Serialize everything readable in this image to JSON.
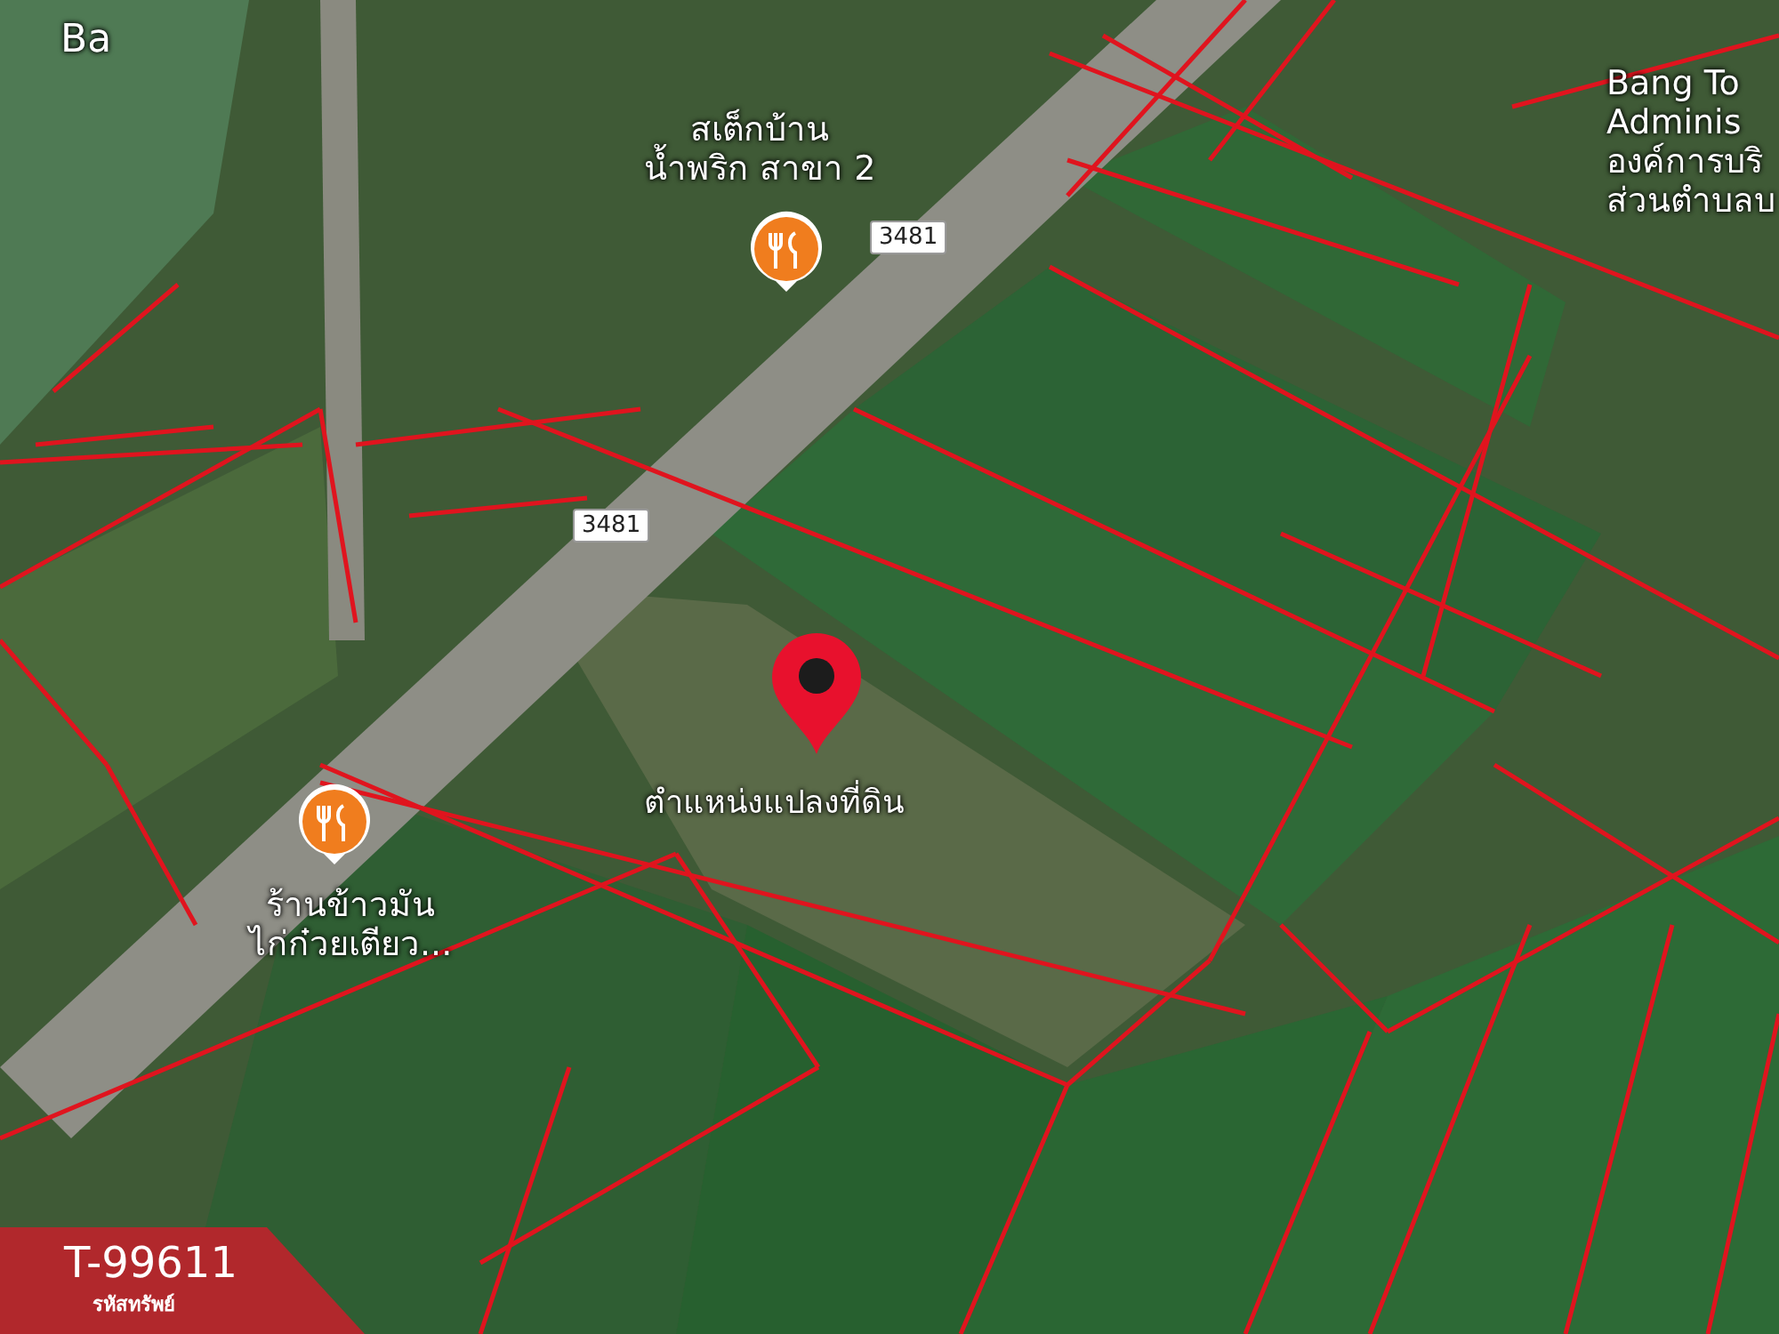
{
  "map": {
    "place_labels": [
      {
        "kind": "place",
        "lines": [
          "Ba"
        ]
      },
      {
        "kind": "place",
        "lines": [
          "สเต็กบ้าน",
          "น้ำพริก สาขา 2"
        ]
      },
      {
        "kind": "place",
        "lines": [
          "Bang To",
          "Adminis",
          "องค์การบริ",
          "ส่วนตำบลบ"
        ]
      },
      {
        "kind": "place",
        "lines": [
          "ร้านข้าวมัน",
          "ไก่ก๋วยเตียว..."
        ]
      },
      {
        "kind": "parcel",
        "lines": [
          "ตำแหน่งแปลงที่ดิน"
        ]
      }
    ],
    "road_shields": [
      "3481",
      "3481"
    ]
  },
  "listing_badge": {
    "code": "T-99611",
    "caption": "รหัสทรัพย์"
  }
}
